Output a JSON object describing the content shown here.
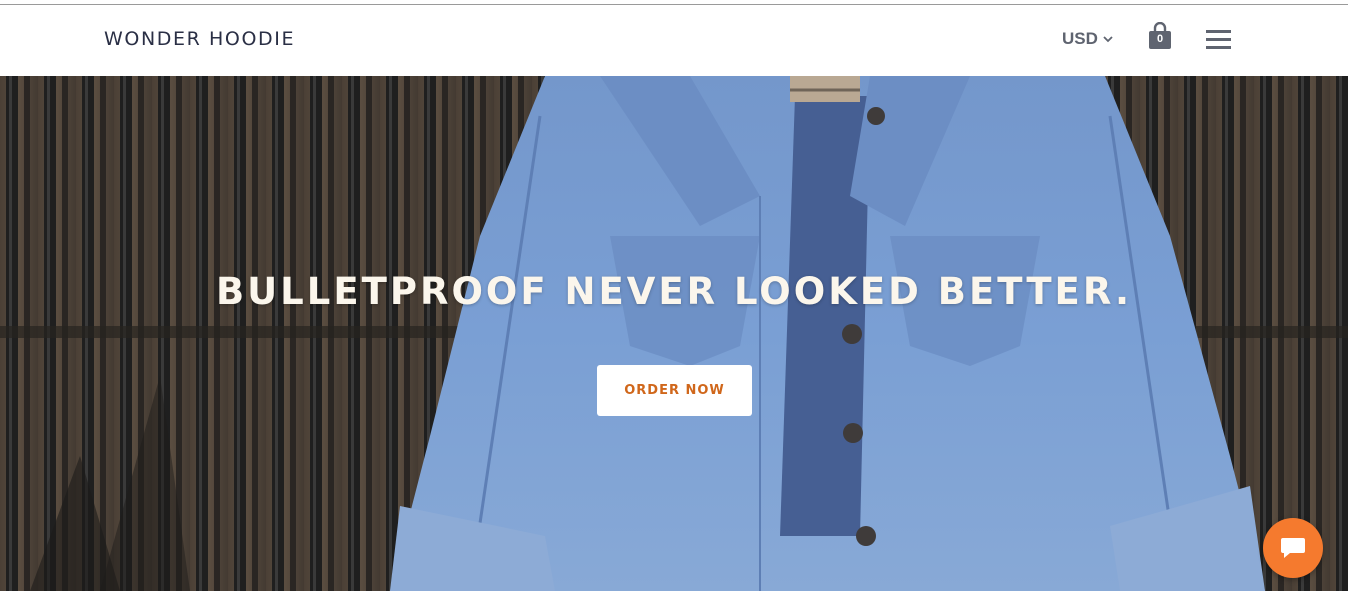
{
  "header": {
    "logo": "WONDER HOODIE",
    "currency": "USD",
    "cart_count": "0"
  },
  "hero": {
    "headline": "BULLETPROOF NEVER LOOKED BETTER.",
    "cta_label": "ORDER NOW"
  },
  "colors": {
    "accent": "#d0671b",
    "chat_button": "#f57a2e",
    "header_text": "#2a2f45",
    "icon_gray": "#5f6470",
    "headline_text": "#fbf6ec"
  },
  "icons": {
    "currency": "chevron-down-icon",
    "cart": "shopping-bag-icon",
    "menu": "hamburger-menu-icon",
    "chat": "chat-bubble-icon"
  }
}
